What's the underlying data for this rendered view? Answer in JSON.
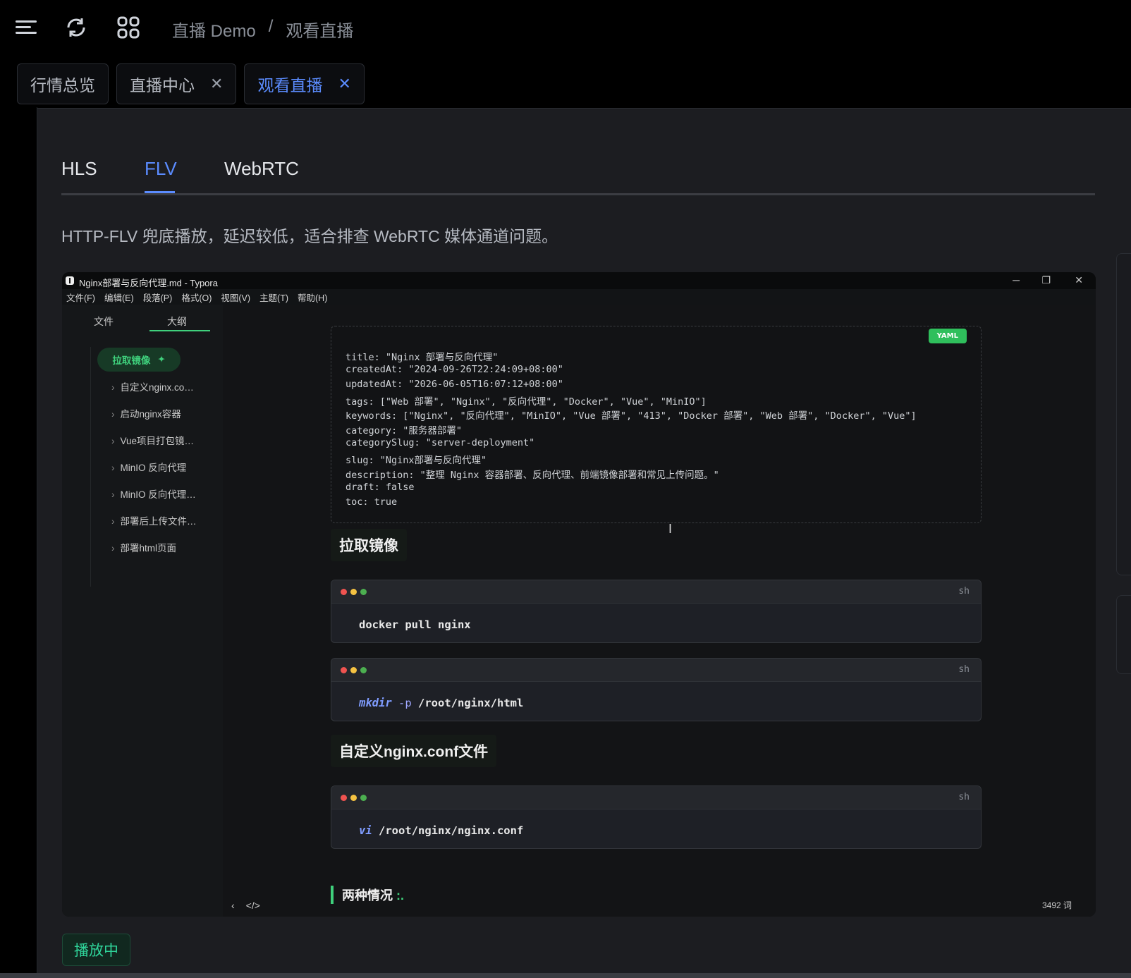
{
  "header": {
    "breadcrumb": [
      "直播 Demo",
      "观看直播"
    ],
    "breadcrumb_sep": "/",
    "icons": [
      "menu-fold-icon",
      "refresh-icon",
      "apps-grid-icon"
    ]
  },
  "page_tabs": [
    {
      "label": "行情总览",
      "closable": false,
      "active": false
    },
    {
      "label": "直播中心",
      "closable": true,
      "active": false,
      "close": "✕"
    },
    {
      "label": "观看直播",
      "closable": true,
      "active": true,
      "close": "✕"
    }
  ],
  "protocol_tabs": {
    "items": [
      "HLS",
      "FLV",
      "WebRTC"
    ],
    "active": "FLV"
  },
  "description": "HTTP-FLV 兜底播放，延迟较低，适合排查 WebRTC 媒体通道问题。",
  "video": {
    "window_title": "Nginx部署与反向代理.md - Typora",
    "window_controls": {
      "minimize": "─",
      "restore": "❐",
      "close": "✕"
    },
    "menu": [
      "文件(F)",
      "编辑(E)",
      "段落(P)",
      "格式(O)",
      "视图(V)",
      "主题(T)",
      "帮助(H)"
    ],
    "outline": {
      "tabs": [
        "文件",
        "大纲"
      ],
      "active_item": "拉取镜像",
      "active_marker": "✦",
      "items": [
        "自定义nginx.co…",
        "启动nginx容器",
        "Vue项目打包镜…",
        "MinIO 反向代理",
        "MinIO 反向代理…",
        "部署后上传文件…",
        "部署html页面"
      ]
    },
    "yaml_badge": "YAML",
    "yaml_lines": [
      "title: \"Nginx 部署与反向代理\"",
      "createdAt: \"2024-09-26T22:24:09+08:00\"",
      "updatedAt: \"2026-06-05T16:07:12+08:00\"",
      "tags: [\"Web 部署\", \"Nginx\", \"反向代理\", \"Docker\", \"Vue\", \"MinIO\"]",
      "keywords: [\"Nginx\", \"反向代理\", \"MinIO\", \"Vue 部署\", \"413\", \"Docker 部署\", \"Web 部署\", \"Docker\", \"Vue\"]",
      "category: \"服务器部署\"",
      "categorySlug: \"server-deployment\"",
      "slug: \"Nginx部署与反向代理\"",
      "description: \"整理 Nginx 容器部署、反向代理、前端镜像部署和常见上传问题。\"",
      "draft: false",
      "toc: true"
    ],
    "heading1": "拉取镜像",
    "code1": {
      "lang": "sh",
      "text": "docker pull nginx"
    },
    "code2": {
      "lang": "sh",
      "cmd": "mkdir",
      "flag": "-p",
      "rest": " /root/nginx/html"
    },
    "heading2": "自定义nginx.conf文件",
    "code3": {
      "lang": "sh",
      "cmd": "vi",
      "rest": " /root/nginx/nginx.conf"
    },
    "quote": "两种情况",
    "quote_suffix": ":.",
    "status_left": [
      "‹",
      "</>"
    ],
    "word_count": "3492 词",
    "colors": {
      "accent": "#3fd07c"
    }
  },
  "status_badge": "播放中",
  "colors": {
    "accent": "#5b8cff",
    "success": "#2fd49a",
    "bg": "#1c1d21"
  }
}
